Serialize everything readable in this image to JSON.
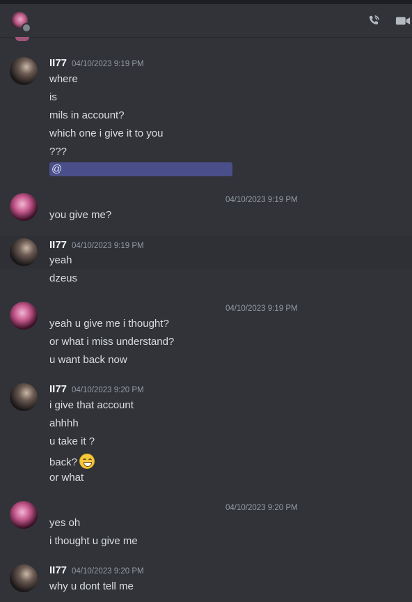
{
  "header": {
    "avatar_icon": "user-avatar",
    "call_icon": "phone-call-icon",
    "video_icon": "video-camera-icon"
  },
  "messages": [
    {
      "author": "II77",
      "timestamp": "04/10/2023 9:19 PM",
      "lines": [
        "where",
        "is",
        "mils in account?",
        "which one i give it to you",
        "???"
      ],
      "mention": "@"
    },
    {
      "timestamp": "04/10/2023 9:19 PM",
      "lines": [
        "you give me?"
      ]
    },
    {
      "author": "II77",
      "timestamp": "04/10/2023 9:19 PM",
      "lines": [
        "yeah",
        "dzeus"
      ]
    },
    {
      "timestamp": "04/10/2023 9:19 PM",
      "lines": [
        "yeah u give me i thought?",
        "or what i miss understand?",
        "u want back now"
      ]
    },
    {
      "author": "II77",
      "timestamp": "04/10/2023 9:20 PM",
      "lines": [
        "i give that account",
        "ahhhh",
        "u take it ?",
        "back?",
        "or what"
      ],
      "emoji": "grinning-face-emoji"
    },
    {
      "timestamp": "04/10/2023 9:20 PM",
      "lines": [
        "yes oh",
        "i thought u give me"
      ]
    },
    {
      "author": "II77",
      "timestamp": "04/10/2023 9:20 PM",
      "lines": [
        "why u dont tell me"
      ]
    }
  ],
  "colors": {
    "background": "#313338",
    "mention_bg": "#4a4f8a",
    "username": "#f2f3f5",
    "timestamp": "#949ba4"
  }
}
